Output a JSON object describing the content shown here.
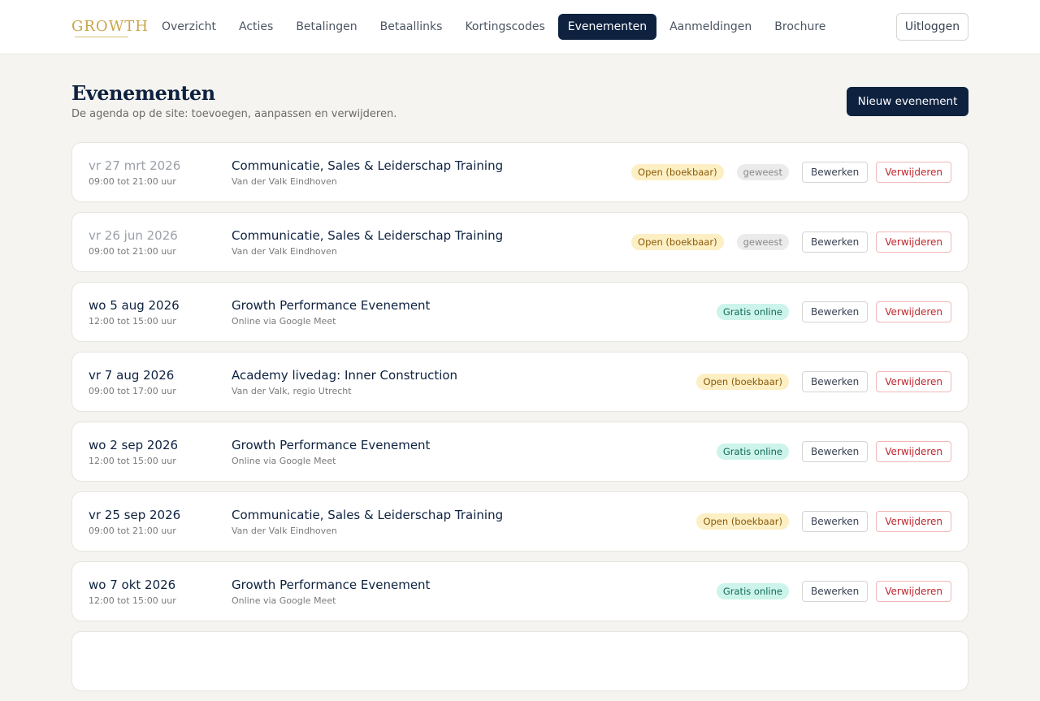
{
  "header": {
    "logo_text": "GROWTH",
    "nav": [
      {
        "label": "Overzicht",
        "active": false
      },
      {
        "label": "Acties",
        "active": false
      },
      {
        "label": "Betalingen",
        "active": false
      },
      {
        "label": "Betaallinks",
        "active": false
      },
      {
        "label": "Kortingscodes",
        "active": false
      },
      {
        "label": "Evenementen",
        "active": true
      },
      {
        "label": "Aanmeldingen",
        "active": false
      },
      {
        "label": "Brochure",
        "active": false
      }
    ],
    "logout_label": "Uitloggen"
  },
  "page": {
    "title": "Evenementen",
    "subtitle": "De agenda op de site: toevoegen, aanpassen en verwijderen.",
    "new_button_label": "Nieuw evenement"
  },
  "labels": {
    "edit": "Bewerken",
    "delete": "Verwijderen"
  },
  "colors": {
    "primary": "#0e2240",
    "background": "#f5f4f0",
    "badge_open_bg": "#fcefc4",
    "badge_gratis_bg": "#cdf4ea",
    "delete_red": "#c0262d"
  },
  "events": [
    {
      "date": "vr 27 mrt 2026",
      "time": "09:00 tot 21:00 uur",
      "title": "Communicatie, Sales & Leiderschap Training",
      "location": "Van der Valk Eindhoven",
      "status": "Open (boekbaar)",
      "status_type": "open",
      "past_label": "geweest",
      "past": true
    },
    {
      "date": "vr 26 jun 2026",
      "time": "09:00 tot 21:00 uur",
      "title": "Communicatie, Sales & Leiderschap Training",
      "location": "Van der Valk Eindhoven",
      "status": "Open (boekbaar)",
      "status_type": "open",
      "past_label": "geweest",
      "past": true
    },
    {
      "date": "wo 5 aug 2026",
      "time": "12:00 tot 15:00 uur",
      "title": "Growth Performance Evenement",
      "location": "Online via Google Meet",
      "status": "Gratis online",
      "status_type": "gratis",
      "past_label": "",
      "past": false
    },
    {
      "date": "vr 7 aug 2026",
      "time": "09:00 tot 17:00 uur",
      "title": "Academy livedag: Inner Construction",
      "location": "Van der Valk, regio Utrecht",
      "status": "Open (boekbaar)",
      "status_type": "open",
      "past_label": "",
      "past": false
    },
    {
      "date": "wo 2 sep 2026",
      "time": "12:00 tot 15:00 uur",
      "title": "Growth Performance Evenement",
      "location": "Online via Google Meet",
      "status": "Gratis online",
      "status_type": "gratis",
      "past_label": "",
      "past": false
    },
    {
      "date": "vr 25 sep 2026",
      "time": "09:00 tot 21:00 uur",
      "title": "Communicatie, Sales & Leiderschap Training",
      "location": "Van der Valk Eindhoven",
      "status": "Open (boekbaar)",
      "status_type": "open",
      "past_label": "",
      "past": false
    },
    {
      "date": "wo 7 okt 2026",
      "time": "12:00 tot 15:00 uur",
      "title": "Growth Performance Evenement",
      "location": "Online via Google Meet",
      "status": "Gratis online",
      "status_type": "gratis",
      "past_label": "",
      "past": false
    }
  ]
}
